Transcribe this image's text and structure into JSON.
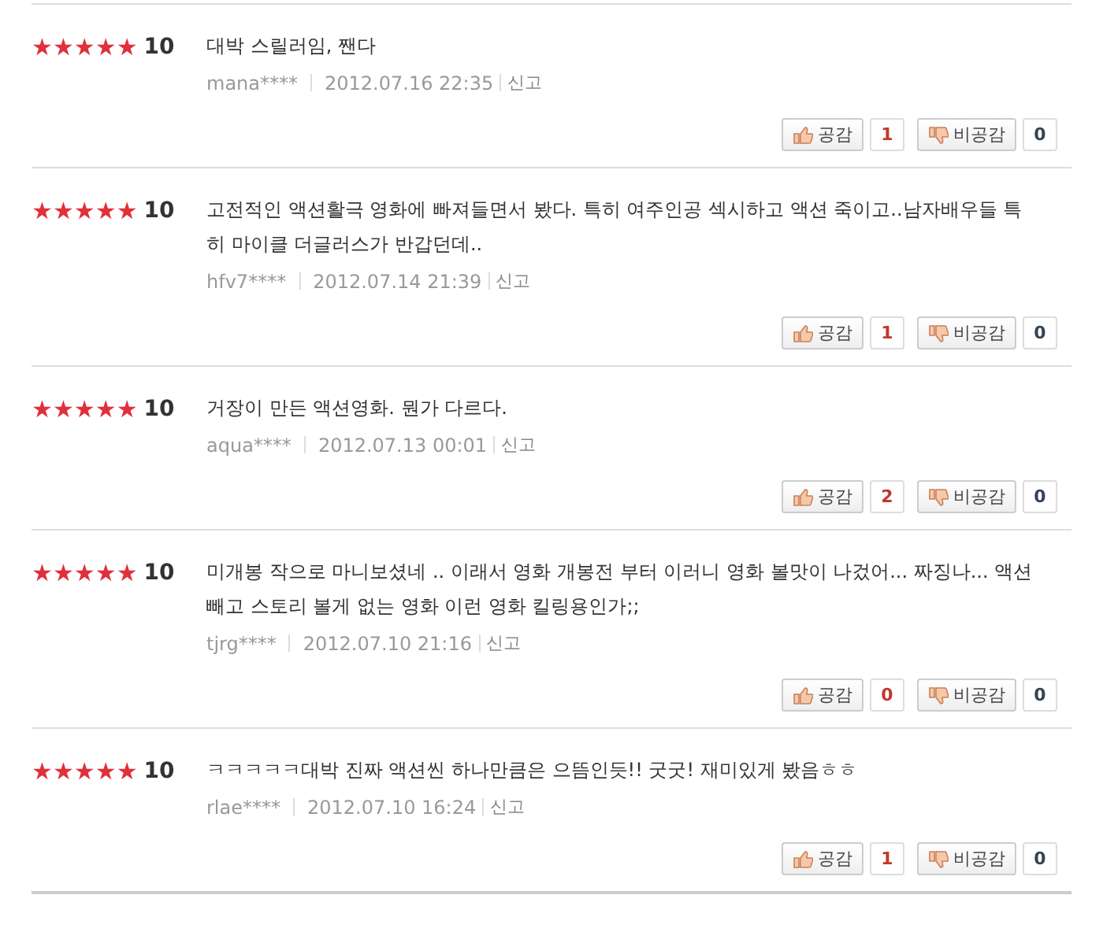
{
  "reviews": [
    {
      "stars": 5,
      "score": "10",
      "text": "대박 스릴러임, 짼다",
      "user": "mana****",
      "date": "2012.07.16 22:35",
      "report": "신고",
      "agree_label": "공감",
      "agree_count": "1",
      "disagree_label": "비공감",
      "disagree_count": "0"
    },
    {
      "stars": 5,
      "score": "10",
      "text": "고전적인 액션활극 영화에 빠져들면서 봤다. 특히 여주인공 섹시하고 액션 죽이고..남자배우들 특히 마이클 더글러스가 반갑던데..",
      "user": "hfv7****",
      "date": "2012.07.14 21:39",
      "report": "신고",
      "agree_label": "공감",
      "agree_count": "1",
      "disagree_label": "비공감",
      "disagree_count": "0"
    },
    {
      "stars": 5,
      "score": "10",
      "text": "거장이 만든 액션영화. 뭔가 다르다.",
      "user": "aqua****",
      "date": "2012.07.13 00:01",
      "report": "신고",
      "agree_label": "공감",
      "agree_count": "2",
      "disagree_label": "비공감",
      "disagree_count": "0"
    },
    {
      "stars": 5,
      "score": "10",
      "text": "미개봉 작으로 마니보셨네 .. 이래서 영화 개봉전 부터 이러니 영화 볼맛이 나겄어... 짜징나... 액션 빼고 스토리 볼게 없는 영화 이런 영화 킬링용인가;;",
      "user": "tjrg****",
      "date": "2012.07.10 21:16",
      "report": "신고",
      "agree_label": "공감",
      "agree_count": "0",
      "disagree_label": "비공감",
      "disagree_count": "0"
    },
    {
      "stars": 5,
      "score": "10",
      "text": "ㅋㅋㅋㅋㅋ대박 진짜 액션씬 하나만큼은 으뜸인듯!! 굿굿! 재미있게 봤음ㅎㅎ",
      "user": "rlae****",
      "date": "2012.07.10 16:24",
      "report": "신고",
      "agree_label": "공감",
      "agree_count": "1",
      "disagree_label": "비공감",
      "disagree_count": "0"
    }
  ]
}
